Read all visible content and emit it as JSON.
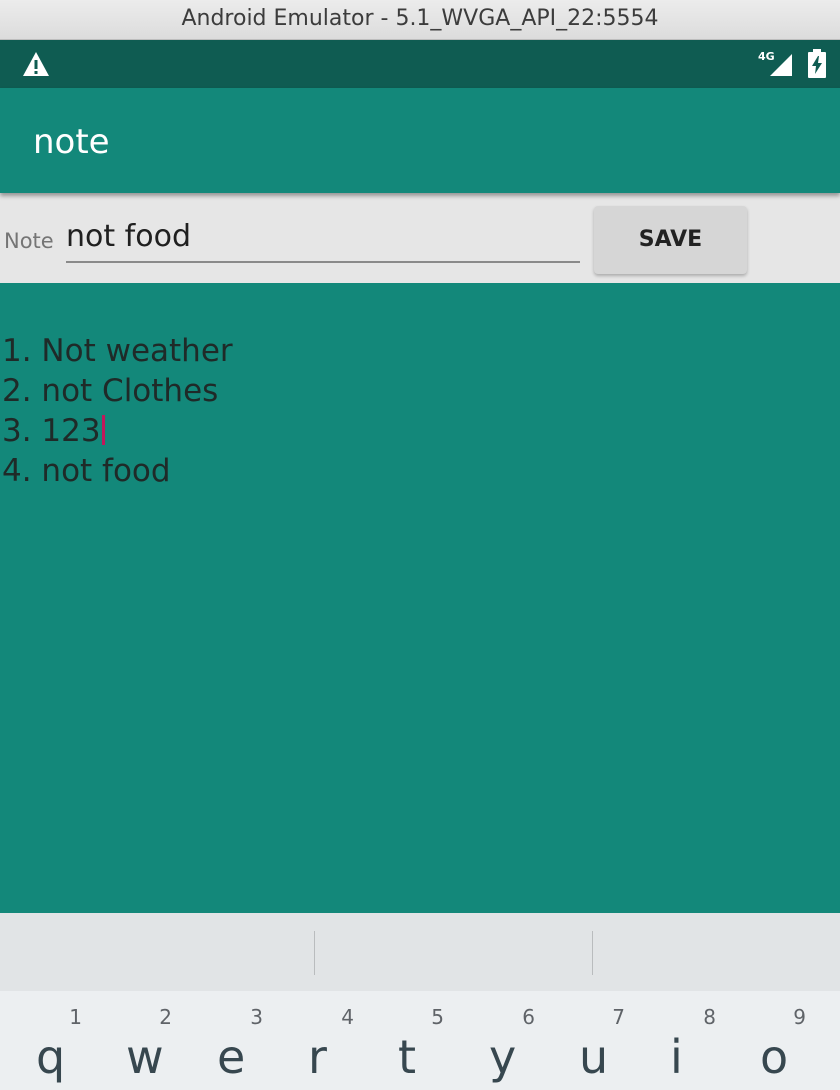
{
  "window": {
    "title": "Android Emulator - 5.1_WVGA_API_22:5554"
  },
  "status_bar": {
    "left_icon": "warning-icon",
    "network_label": "4G",
    "network_icon": "signal-icon",
    "battery_icon": "battery-charging-icon"
  },
  "app_bar": {
    "title": "note"
  },
  "note_input": {
    "label": "Note",
    "value": "not food"
  },
  "save_button": {
    "label": "SAVE"
  },
  "notes": [
    "1. Not weather",
    "2. not Clothes",
    "3. 123",
    "4. not food"
  ],
  "keyboard": {
    "keys": [
      {
        "letter": "q",
        "hint": "1"
      },
      {
        "letter": "w",
        "hint": "2"
      },
      {
        "letter": "e",
        "hint": "3"
      },
      {
        "letter": "r",
        "hint": "4"
      },
      {
        "letter": "t",
        "hint": "5"
      },
      {
        "letter": "y",
        "hint": "6"
      },
      {
        "letter": "u",
        "hint": "7"
      },
      {
        "letter": "i",
        "hint": "8"
      },
      {
        "letter": "o",
        "hint": "9"
      }
    ]
  },
  "colors": {
    "status_bar": "#0f5c52",
    "primary": "#13887a",
    "caret": "#c2185b",
    "input_row": "#e6e6e6"
  }
}
